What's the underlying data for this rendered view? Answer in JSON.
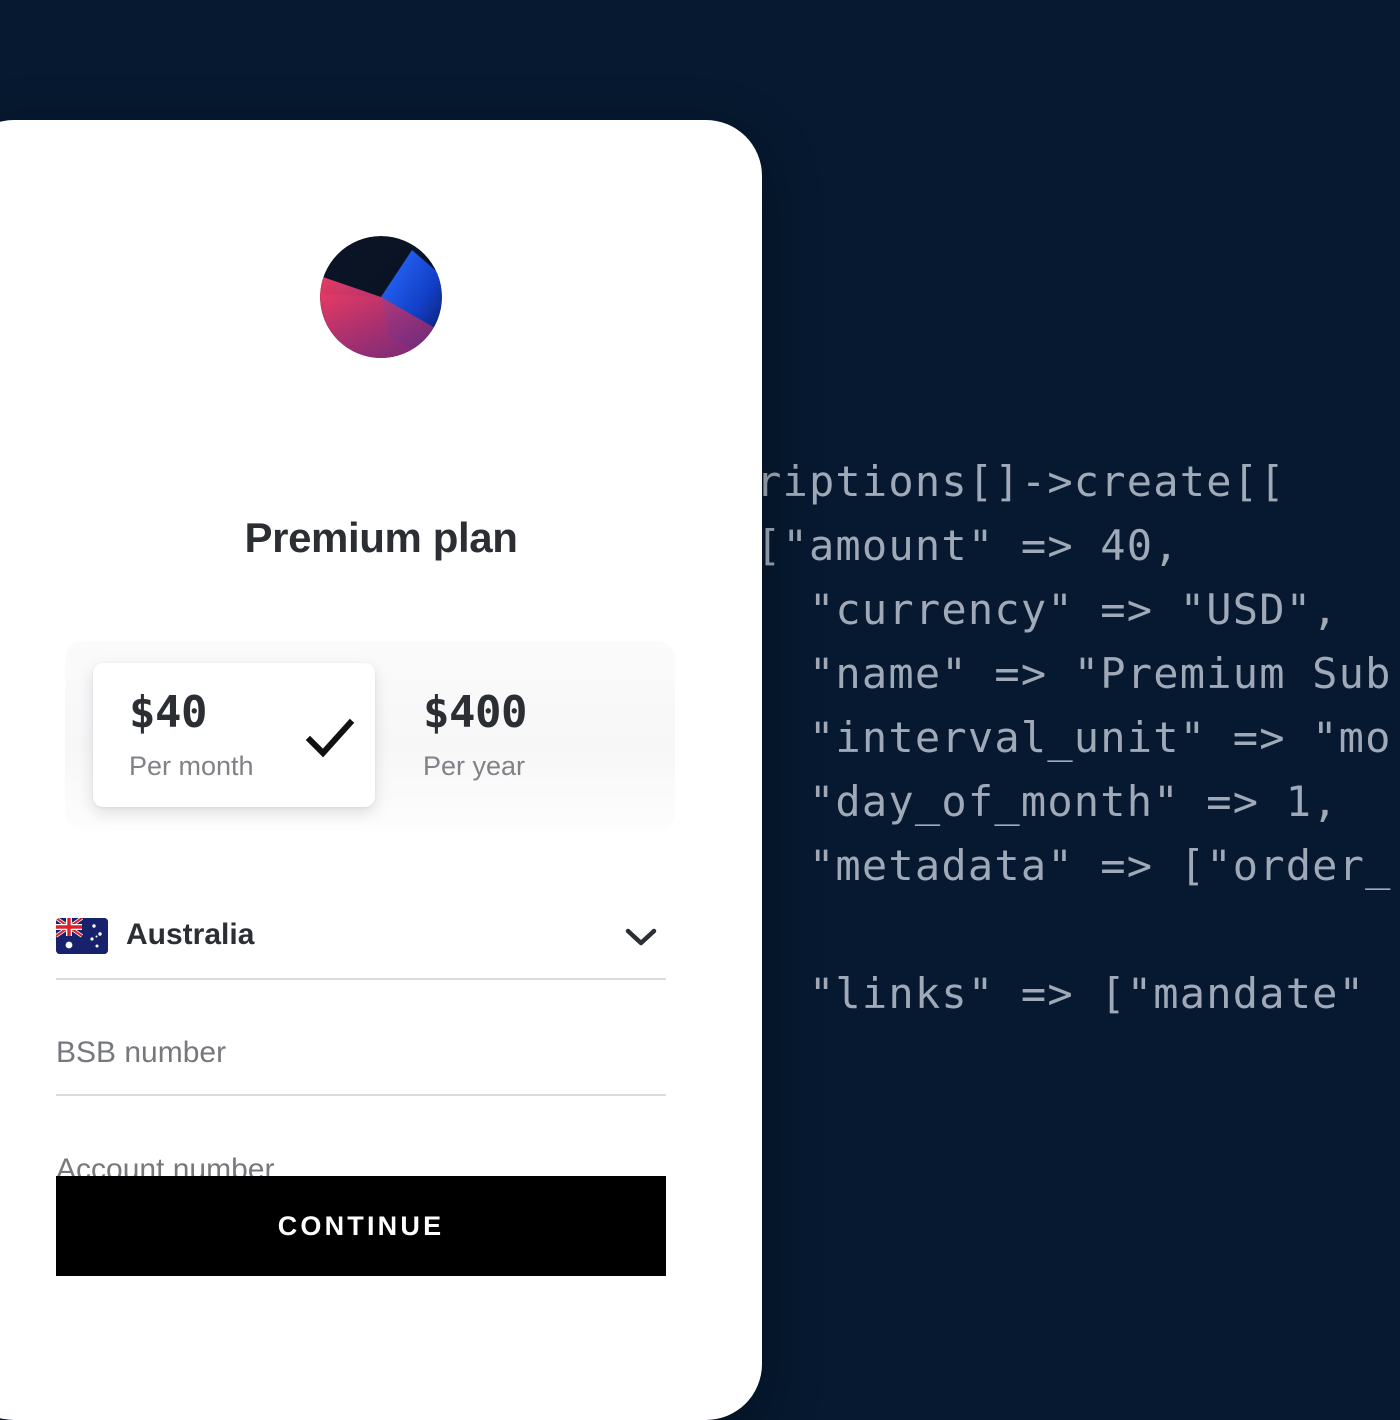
{
  "theme": {
    "background": "#061930",
    "card_background": "#ffffff",
    "accent_button": "#000000",
    "code_text": "#9fa9b7",
    "muted_text": "#76787d",
    "heading_text": "#2b2e33"
  },
  "code_panel": {
    "language": "php",
    "lines": [
      "scriptions[]->create[[",
      "  [\"amount\" => 40,",
      "    \"currency\" => \"USD\",",
      "    \"name\" => \"Premium Sub",
      "    \"interval_unit\" => \"mo",
      "    \"day_of_month\" => 1,",
      "    \"metadata\" => [\"order_",
      "",
      "    \"links\" => [\"mandate\""
    ]
  },
  "card": {
    "logo": {
      "icon": "pie-sphere-logo",
      "colors": [
        "#0a1528",
        "#d7395f",
        "#8c2f7a",
        "#1d5bf0",
        "#0e1a6b"
      ]
    },
    "title": "Premium plan",
    "pricing": {
      "options": [
        {
          "amount": "$40",
          "period": "Per month",
          "selected": true,
          "check_icon": "check-icon"
        },
        {
          "amount": "$400",
          "period": "Per year",
          "selected": false
        }
      ]
    },
    "fields": {
      "country": {
        "label": "Australia",
        "flag_icon": "flag-australia-icon",
        "chevron_icon": "chevron-down-icon"
      },
      "bsb": {
        "placeholder": "BSB number",
        "value": ""
      },
      "account": {
        "placeholder": "Account number",
        "value": ""
      }
    },
    "continue_label": "CONTINUE"
  }
}
